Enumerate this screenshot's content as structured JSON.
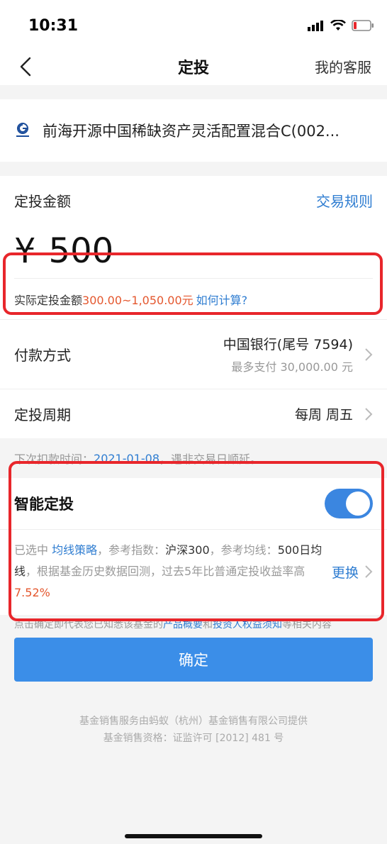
{
  "status_bar": {
    "time": "10:31"
  },
  "nav": {
    "title": "定投",
    "service": "我的客服"
  },
  "fund": {
    "name": "前海开源中国稀缺资产灵活配置混合C(002..."
  },
  "amount": {
    "label": "定投金额",
    "rules_link": "交易规则",
    "currency": "¥",
    "value": "500",
    "actual_prefix": "实际定投金额",
    "actual_range": "300.00~1,050.00元",
    "how_link": "如何计算?"
  },
  "payment": {
    "label": "付款方式",
    "bank": "中国银行(尾号 7594)",
    "limit": "最多支付 30,000.00 元"
  },
  "cycle": {
    "label": "定投周期",
    "value": "每周 周五"
  },
  "next_debit": {
    "prefix": "下次扣款时间：",
    "date": "2021-01-08",
    "suffix": "，遇非交易日顺延。"
  },
  "smart": {
    "title": "智能定投",
    "enabled": true,
    "desc": {
      "p1": "已选中 ",
      "strategy": "均线策略",
      "p2": "，参考指数：",
      "index": "沪深300",
      "p3": "，参考均线：",
      "ma": "500日均线",
      "p4": "，根据基金历史数据回测，过去5年比普通定投收益率高",
      "rate": "7.52%"
    },
    "change": "更换"
  },
  "agreement": {
    "p1": "点击确定即代表您已知悉该基金的",
    "link1": "产品概要",
    "p2": "和",
    "link2": "投资人权益须知",
    "p3": "等相关内容"
  },
  "confirm": "确定",
  "footer": {
    "line1": "基金销售服务由蚂蚁（杭州）基金销售有限公司提供",
    "line2": "基金销售资格：证监许可 [2012] 481 号"
  },
  "colors": {
    "accent": "#2f7dd1",
    "button": "#3b8ee8",
    "highlight": "#e4572e",
    "annotation": "#e8262b"
  }
}
